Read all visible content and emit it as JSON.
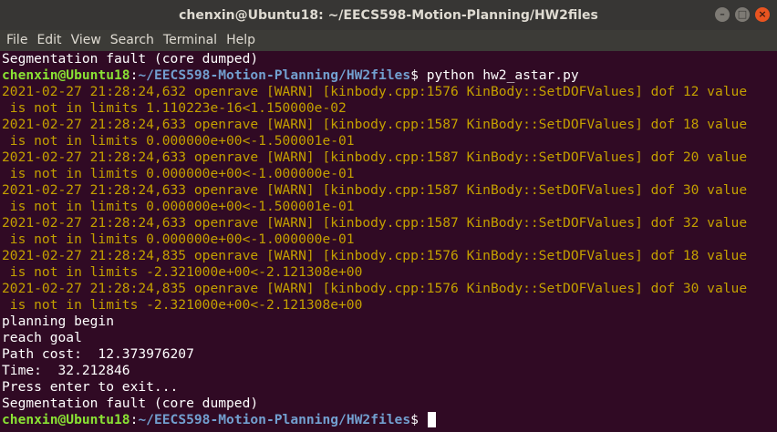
{
  "window": {
    "title": "chenxin@Ubuntu18: ~/EECS598-Motion-Planning/HW2files",
    "controls": [
      {
        "name": "minimize-button",
        "glyph": "–"
      },
      {
        "name": "maximize-button",
        "glyph": "□"
      },
      {
        "name": "close-button",
        "glyph": "×"
      }
    ]
  },
  "menu": [
    "File",
    "Edit",
    "View",
    "Search",
    "Terminal",
    "Help"
  ],
  "prompt": {
    "user": "chenxin@Ubuntu18",
    "sep": ":",
    "path": "~/EECS598-Motion-Planning/HW2files",
    "sign": "$"
  },
  "colors": {
    "background": "#300a24",
    "prompt_user": "#8ae234",
    "prompt_path": "#729fcf",
    "warning": "#c4a000",
    "text": "#ffffff"
  },
  "terminal": {
    "lines": [
      {
        "t": "Segmentation fault (core dumped)"
      },
      {
        "t": "prompt",
        "cmd": " python hw2_astar.py"
      },
      {
        "t": "2021-02-27 21:28:24,632 openrave [WARN] [kinbody.cpp:1576 KinBody::SetDOFValues] dof 12 value",
        "k": "warn"
      },
      {
        "t": " is not in limits 1.110223e-16<1.150000e-02",
        "k": "warn"
      },
      {
        "t": "2021-02-27 21:28:24,633 openrave [WARN] [kinbody.cpp:1587 KinBody::SetDOFValues] dof 18 value",
        "k": "warn"
      },
      {
        "t": " is not in limits 0.000000e+00<-1.500001e-01",
        "k": "warn"
      },
      {
        "t": "2021-02-27 21:28:24,633 openrave [WARN] [kinbody.cpp:1587 KinBody::SetDOFValues] dof 20 value",
        "k": "warn"
      },
      {
        "t": " is not in limits 0.000000e+00<-1.000000e-01",
        "k": "warn"
      },
      {
        "t": "2021-02-27 21:28:24,633 openrave [WARN] [kinbody.cpp:1587 KinBody::SetDOFValues] dof 30 value",
        "k": "warn"
      },
      {
        "t": " is not in limits 0.000000e+00<-1.500001e-01",
        "k": "warn"
      },
      {
        "t": "2021-02-27 21:28:24,633 openrave [WARN] [kinbody.cpp:1587 KinBody::SetDOFValues] dof 32 value",
        "k": "warn"
      },
      {
        "t": " is not in limits 0.000000e+00<-1.000000e-01",
        "k": "warn"
      },
      {
        "t": "2021-02-27 21:28:24,835 openrave [WARN] [kinbody.cpp:1576 KinBody::SetDOFValues] dof 18 value",
        "k": "warn"
      },
      {
        "t": " is not in limits -2.321000e+00<-2.121308e+00",
        "k": "warn"
      },
      {
        "t": "2021-02-27 21:28:24,835 openrave [WARN] [kinbody.cpp:1576 KinBody::SetDOFValues] dof 30 value",
        "k": "warn"
      },
      {
        "t": " is not in limits -2.321000e+00<-2.121308e+00",
        "k": "warn"
      },
      {
        "t": "planning begin"
      },
      {
        "t": "reach goal"
      },
      {
        "t": "Path cost:  12.373976207"
      },
      {
        "t": "Time:  32.212846"
      },
      {
        "t": "Press enter to exit..."
      },
      {
        "t": "Segmentation fault (core dumped)"
      },
      {
        "t": "prompt",
        "cmd": " ",
        "cursor": true
      }
    ]
  }
}
